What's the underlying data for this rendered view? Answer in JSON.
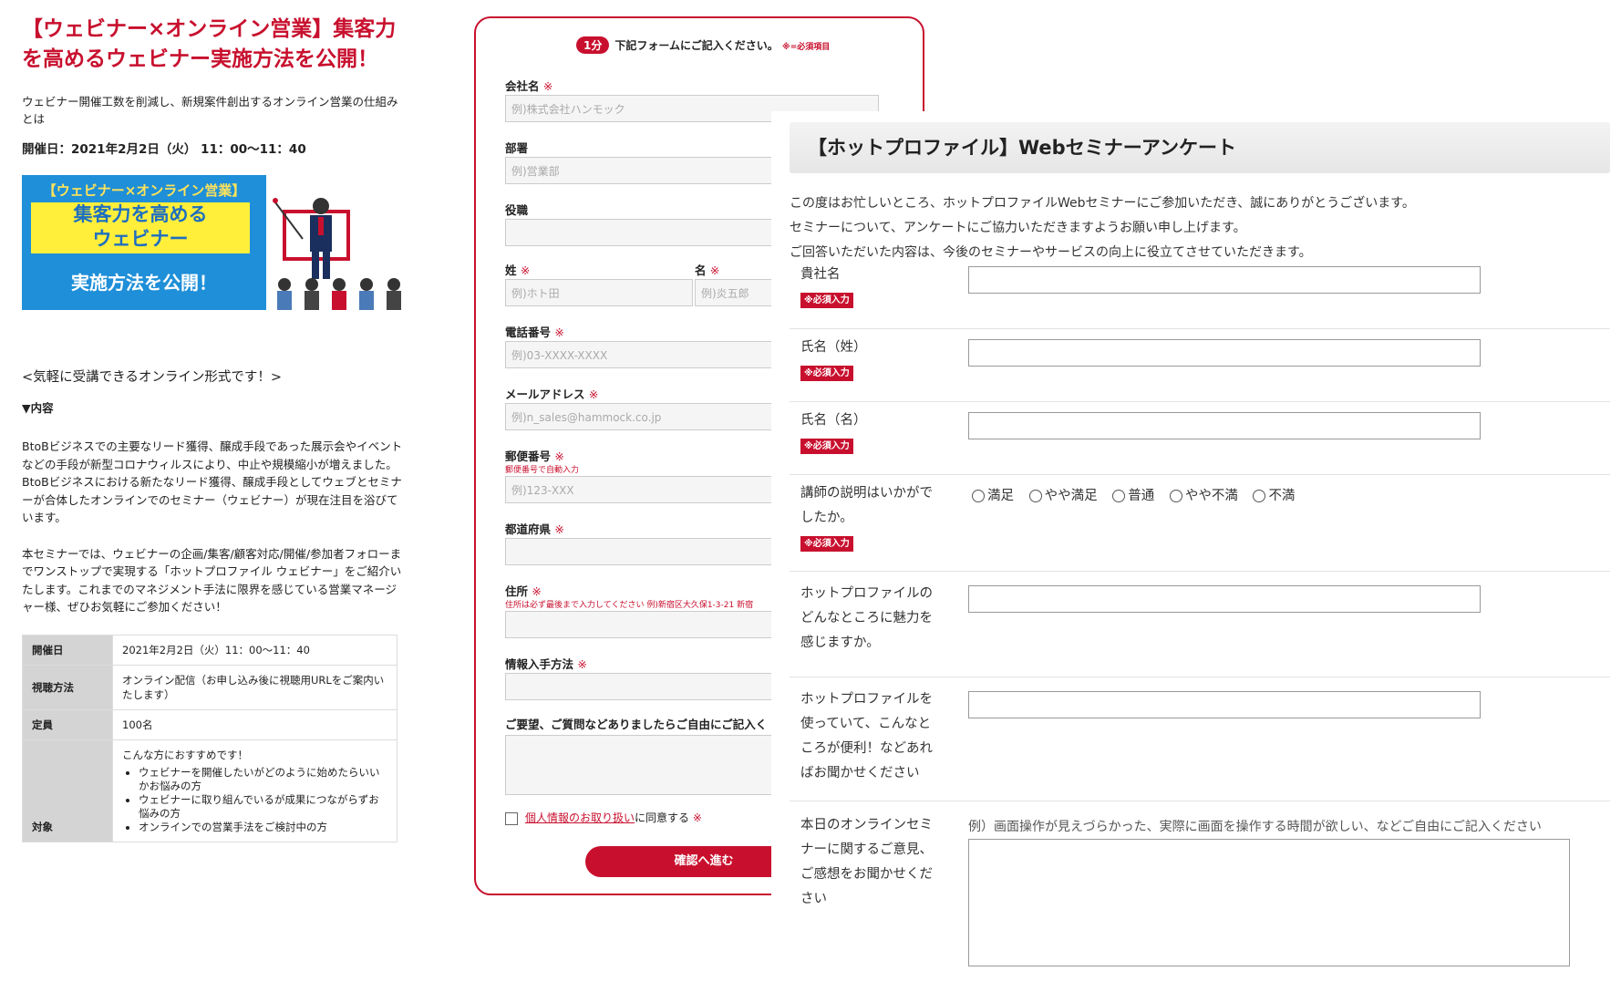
{
  "left": {
    "title": "【ウェビナー×オンライン営業】集客力を高めるウェビナー実施方法を公開！",
    "lead": "ウェビナー開催工数を削減し、新規案件創出するオンライン営業の仕組みとは",
    "date_line": "開催日：2021年2月2日（火） 11：00〜11：40",
    "banner": {
      "top": "【ウェビナー×オンライン営業】",
      "mid_line1": "集客力を高める",
      "mid_line2": "ウェビナー",
      "bottom": "実施方法を公開！"
    },
    "sub_head": "<気軽に受講できるオンライン形式です！>",
    "content_head": "▼内容",
    "para1": "BtoBビジネスでの主要なリード獲得、醸成手段であった展示会やイベントなどの手段が新型コロナウィルスにより、中止や規模縮小が増えました。BtoBビジネスにおける新たなリード獲得、醸成手段としてウェブとセミナーが合体したオンラインでのセミナー（ウェビナー）が現在注目を浴びています。",
    "para2": "本セミナーでは、ウェビナーの企画/集客/顧客対応/開催/参加者フォローまでワンストップで実現する「ホットプロファイル ウェビナー」をご紹介いたします。これまでのマネジメント手法に限界を感じている営業マネージャー様、ぜひお気軽にご参加ください！",
    "table": [
      {
        "key": "開催日",
        "value": "2021年2月2日（火）11：00〜11：40"
      },
      {
        "key": "視聴方法",
        "value": "オンライン配信（お申し込み後に視聴用URLをご案内いたします）"
      },
      {
        "key": "定員",
        "value": "100名"
      }
    ],
    "target": {
      "key": "対象",
      "intro": "こんな方におすすめです！",
      "items": [
        "ウェビナーを開催したいがどのように始めたらいいかお悩みの方",
        "ウェビナーに取り組んでいるが成果につながらずお悩みの方",
        "オンラインでの営業手法をご検討中の方"
      ]
    }
  },
  "mid": {
    "pill": "1分",
    "top_text": "下記フォームにご記入ください。",
    "req_note": "※=必須項目",
    "req_mark": "※",
    "fields": {
      "company": {
        "label": "会社名",
        "placeholder": "例)株式会社ハンモック"
      },
      "dept": {
        "label": "部署",
        "placeholder": "例)営業部"
      },
      "position": {
        "label": "役職"
      },
      "last": {
        "label": "姓",
        "placeholder": "例)ホト田"
      },
      "first": {
        "label": "名",
        "placeholder": "例)炎五郎"
      },
      "phone": {
        "label": "電話番号",
        "placeholder": "例)03-XXXX-XXXX"
      },
      "email": {
        "label": "メールアドレス",
        "placeholder": "例)n_sales@hammock.co.jp"
      },
      "zip": {
        "label": "郵便番号",
        "hint": "郵便番号で自動入力",
        "placeholder": "例)123-XXX"
      },
      "pref": {
        "label": "都道府県"
      },
      "address": {
        "label": "住所",
        "hint": "住所は必ず最後まで入力してください 例)新宿区大久保1-3-21 新宿"
      },
      "source": {
        "label": "情報入手方法"
      },
      "comments": {
        "label": "ご要望、ご質問などありましたらご自由にご記入く"
      }
    },
    "agree_link": "個人情報のお取り扱い",
    "agree_text": "に同意する",
    "confirm": "確認へ進む"
  },
  "survey": {
    "title": "【ホットプロファイル】Webセミナーアンケート",
    "intro1": "この度はお忙しいところ、ホットプロファイルWebセミナーにご参加いただき、誠にありがとうございます。",
    "intro2": "セミナーについて、アンケートにご協力いただきますようお願い申し上げます。",
    "intro3": "ご回答いただいた内容は、今後のセミナーやサービスの向上に役立てさせていただきます。",
    "required": "※必須入力",
    "q_company": "貴社名",
    "q_last": "氏名（姓）",
    "q_first": "氏名（名）",
    "q_lecturer": "講師の説明はいかがでしたか。",
    "radio_options": [
      "満足",
      "やや満足",
      "普通",
      "やや不満",
      "不満"
    ],
    "q_appeal": "ホットプロファイルのどんなところに魅力を感じますか。",
    "q_useful": "ホットプロファイルを使っていて、こんなところが便利！などあればお聞かせください",
    "q_opinion": "本日のオンラインセミナーに関するご意見、ご感想をお聞かせください",
    "opinion_hint": "例）画面操作が見えづらかった、実際に画面を操作する時間が欲しい、などご自由にご記入ください"
  }
}
